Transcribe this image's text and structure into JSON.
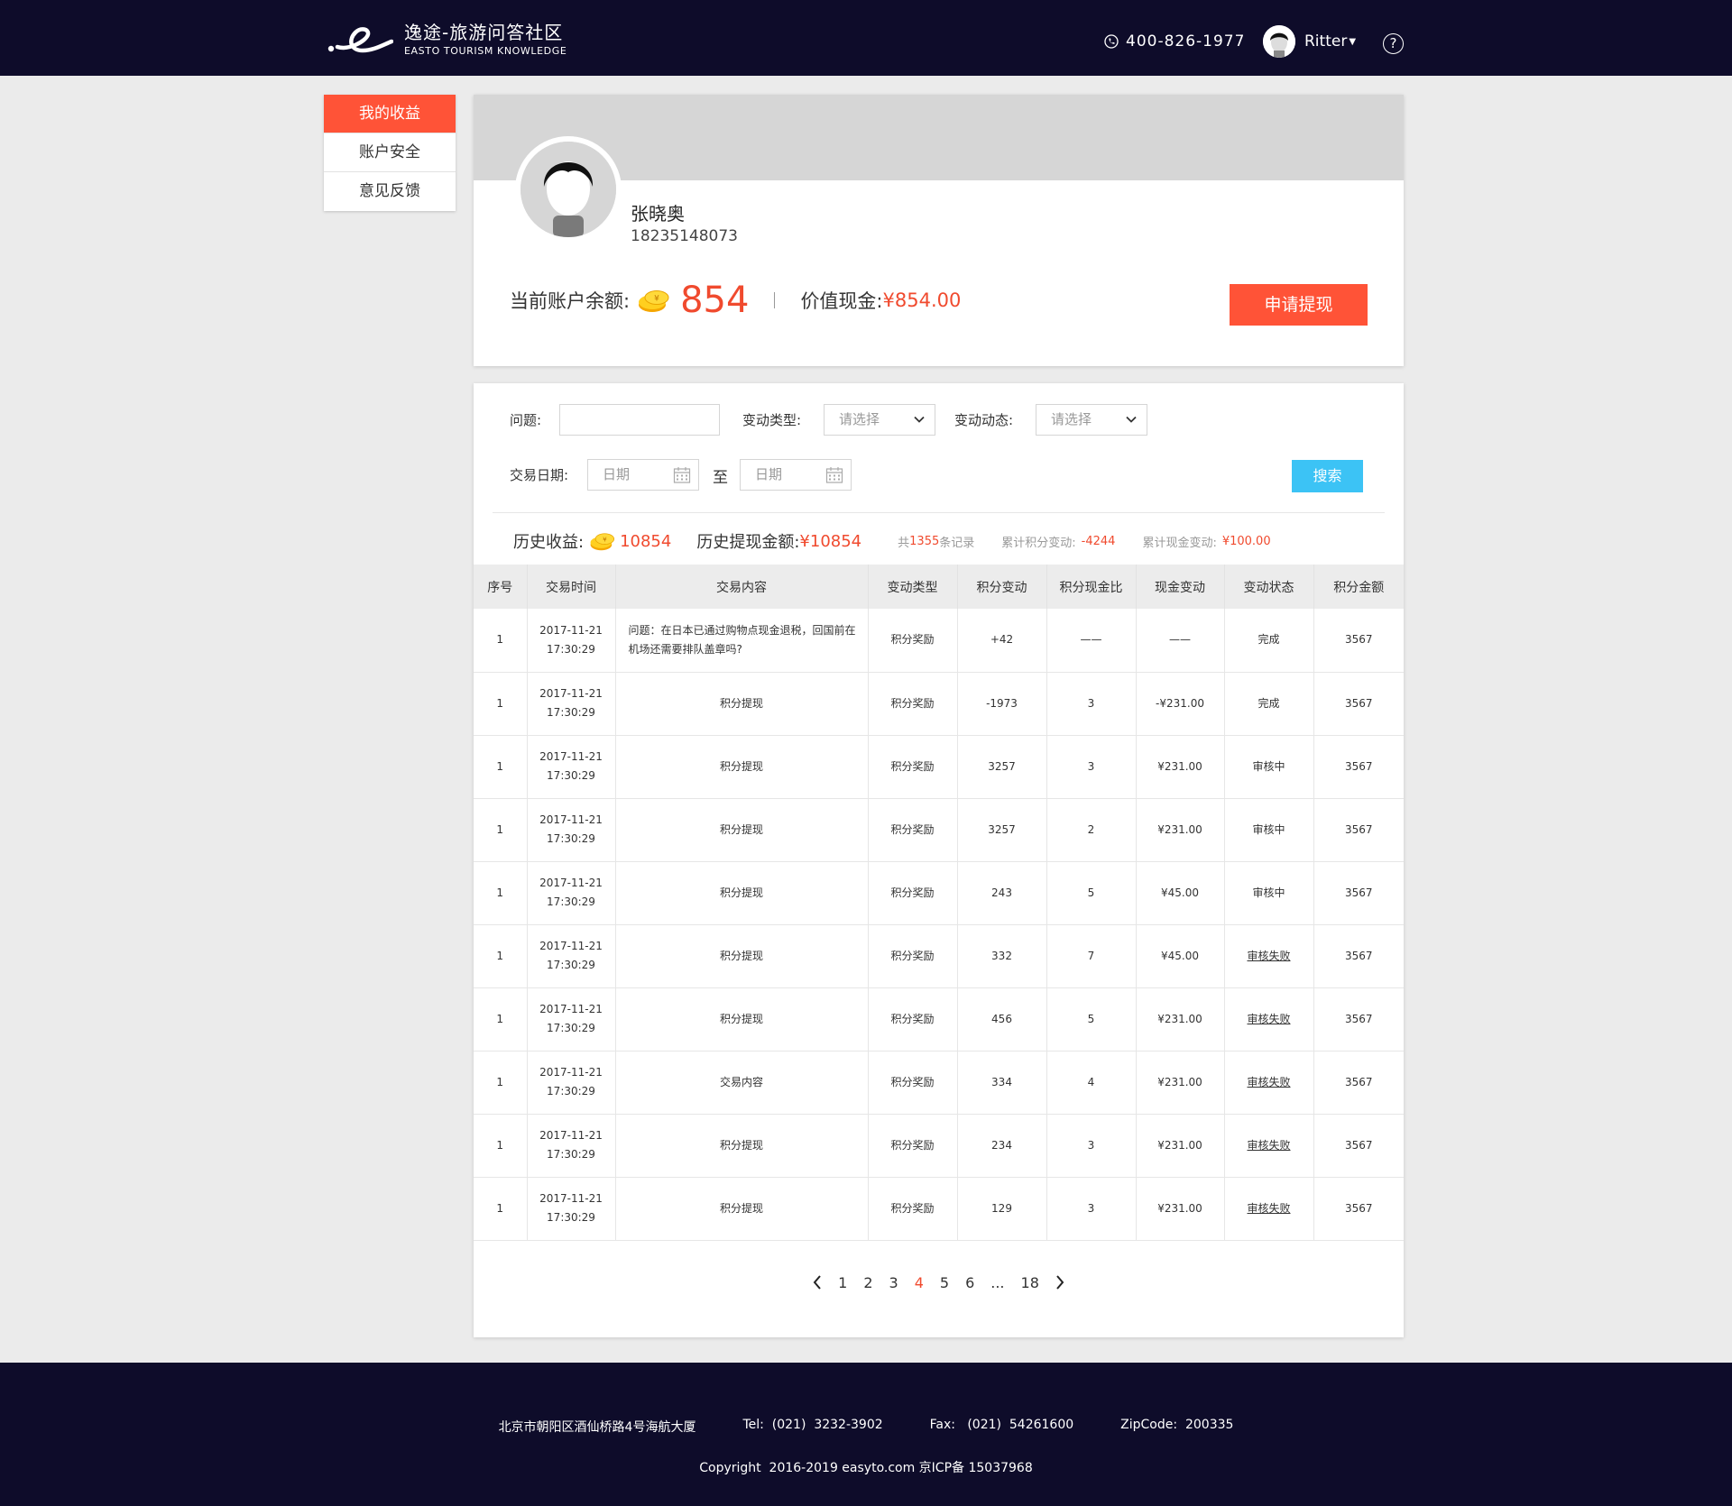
{
  "header": {
    "logo_cn": "逸途-旅游问答社区",
    "logo_en": "EASTO TOURISM KNOWLEDGE",
    "phone": "400-826-1977",
    "username": "Ritter",
    "help": "?"
  },
  "sidebar": {
    "items": [
      {
        "label": "我的收益",
        "active": true
      },
      {
        "label": "账户安全",
        "active": false
      },
      {
        "label": "意见反馈",
        "active": false
      }
    ]
  },
  "profile": {
    "name": "张晓奥",
    "phone": "18235148073",
    "balance_label": "当前账户余额:",
    "balance": "854",
    "cash_label": "价值现金:",
    "cash": "¥854.00",
    "withdraw_button": "申请提现"
  },
  "filters": {
    "question_label": "问题:",
    "question_value": "",
    "type_label": "变动类型:",
    "type_placeholder": "请选择",
    "dynamic_label": "变动动态:",
    "dynamic_placeholder": "请选择",
    "date_label": "交易日期:",
    "date_from_placeholder": "日期",
    "to_label": "至",
    "date_to_placeholder": "日期",
    "search_button": "搜索"
  },
  "stats": {
    "history_income_label": "历史收益:",
    "history_income": "10854",
    "history_withdraw_label": "历史提现金额:",
    "history_withdraw": "¥10854",
    "records_prefix": "共",
    "records_count": "1355",
    "records_suffix": "条记录",
    "points_change_label": "累计积分变动:",
    "points_change": "-4244",
    "cash_change_label": "累计现金变动:",
    "cash_change": "¥100.00"
  },
  "table": {
    "columns": [
      "序号",
      "交易时间",
      "交易内容",
      "变动类型",
      "积分变动",
      "积分现金比",
      "现金变动",
      "变动状态",
      "积分金额"
    ],
    "rows": [
      {
        "no": "1",
        "date": "2017-11-21",
        "time": "17:30:29",
        "content": "问题：在日本已通过购物点现金退税，回国前在机场还需要排队盖章吗?",
        "type": "积分奖励",
        "points": "+42",
        "ratio": "——",
        "cash": "——",
        "status": "完成",
        "amount": "3567"
      },
      {
        "no": "1",
        "date": "2017-11-21",
        "time": "17:30:29",
        "content": "积分提现",
        "type": "积分奖励",
        "points": "-1973",
        "ratio": "3",
        "cash": "-¥231.00",
        "status": "完成",
        "amount": "3567"
      },
      {
        "no": "1",
        "date": "2017-11-21",
        "time": "17:30:29",
        "content": "积分提现",
        "type": "积分奖励",
        "points": "3257",
        "ratio": "3",
        "cash": "¥231.00",
        "status": "审核中",
        "amount": "3567"
      },
      {
        "no": "1",
        "date": "2017-11-21",
        "time": "17:30:29",
        "content": "积分提现",
        "type": "积分奖励",
        "points": "3257",
        "ratio": "2",
        "cash": "¥231.00",
        "status": "审核中",
        "amount": "3567"
      },
      {
        "no": "1",
        "date": "2017-11-21",
        "time": "17:30:29",
        "content": "积分提现",
        "type": "积分奖励",
        "points": "243",
        "ratio": "5",
        "cash": "¥45.00",
        "status": "审核中",
        "amount": "3567"
      },
      {
        "no": "1",
        "date": "2017-11-21",
        "time": "17:30:29",
        "content": "积分提现",
        "type": "积分奖励",
        "points": "332",
        "ratio": "7",
        "cash": "¥45.00",
        "status": "审核失败",
        "amount": "3567"
      },
      {
        "no": "1",
        "date": "2017-11-21",
        "time": "17:30:29",
        "content": "积分提现",
        "type": "积分奖励",
        "points": "456",
        "ratio": "5",
        "cash": "¥231.00",
        "status": "审核失败",
        "amount": "3567"
      },
      {
        "no": "1",
        "date": "2017-11-21",
        "time": "17:30:29",
        "content": "交易内容",
        "type": "积分奖励",
        "points": "334",
        "ratio": "4",
        "cash": "¥231.00",
        "status": "审核失败",
        "amount": "3567"
      },
      {
        "no": "1",
        "date": "2017-11-21",
        "time": "17:30:29",
        "content": "积分提现",
        "type": "积分奖励",
        "points": "234",
        "ratio": "3",
        "cash": "¥231.00",
        "status": "审核失败",
        "amount": "3567"
      },
      {
        "no": "1",
        "date": "2017-11-21",
        "time": "17:30:29",
        "content": "积分提现",
        "type": "积分奖励",
        "points": "129",
        "ratio": "3",
        "cash": "¥231.00",
        "status": "审核失败",
        "amount": "3567"
      }
    ]
  },
  "pagination": {
    "pages": [
      "1",
      "2",
      "3",
      "4",
      "5",
      "6",
      "...",
      "18"
    ],
    "current": "4"
  },
  "footer": {
    "address": "北京市朝阳区酒仙桥路4号海航大厦",
    "tel": "Tel:  (021)  3232-3902",
    "fax": "Fax:   (021)  54261600",
    "zip": "ZipCode:  200335",
    "copyright": "Copyright  2016-2019 easyto.com 京ICP备 15037968"
  },
  "colors": {
    "accent": "#ff5337",
    "header_bg": "#0e0c2a",
    "search_btn": "#3cc3f5",
    "value_red": "#f04a2e",
    "link_blue": "#3b92f5"
  }
}
